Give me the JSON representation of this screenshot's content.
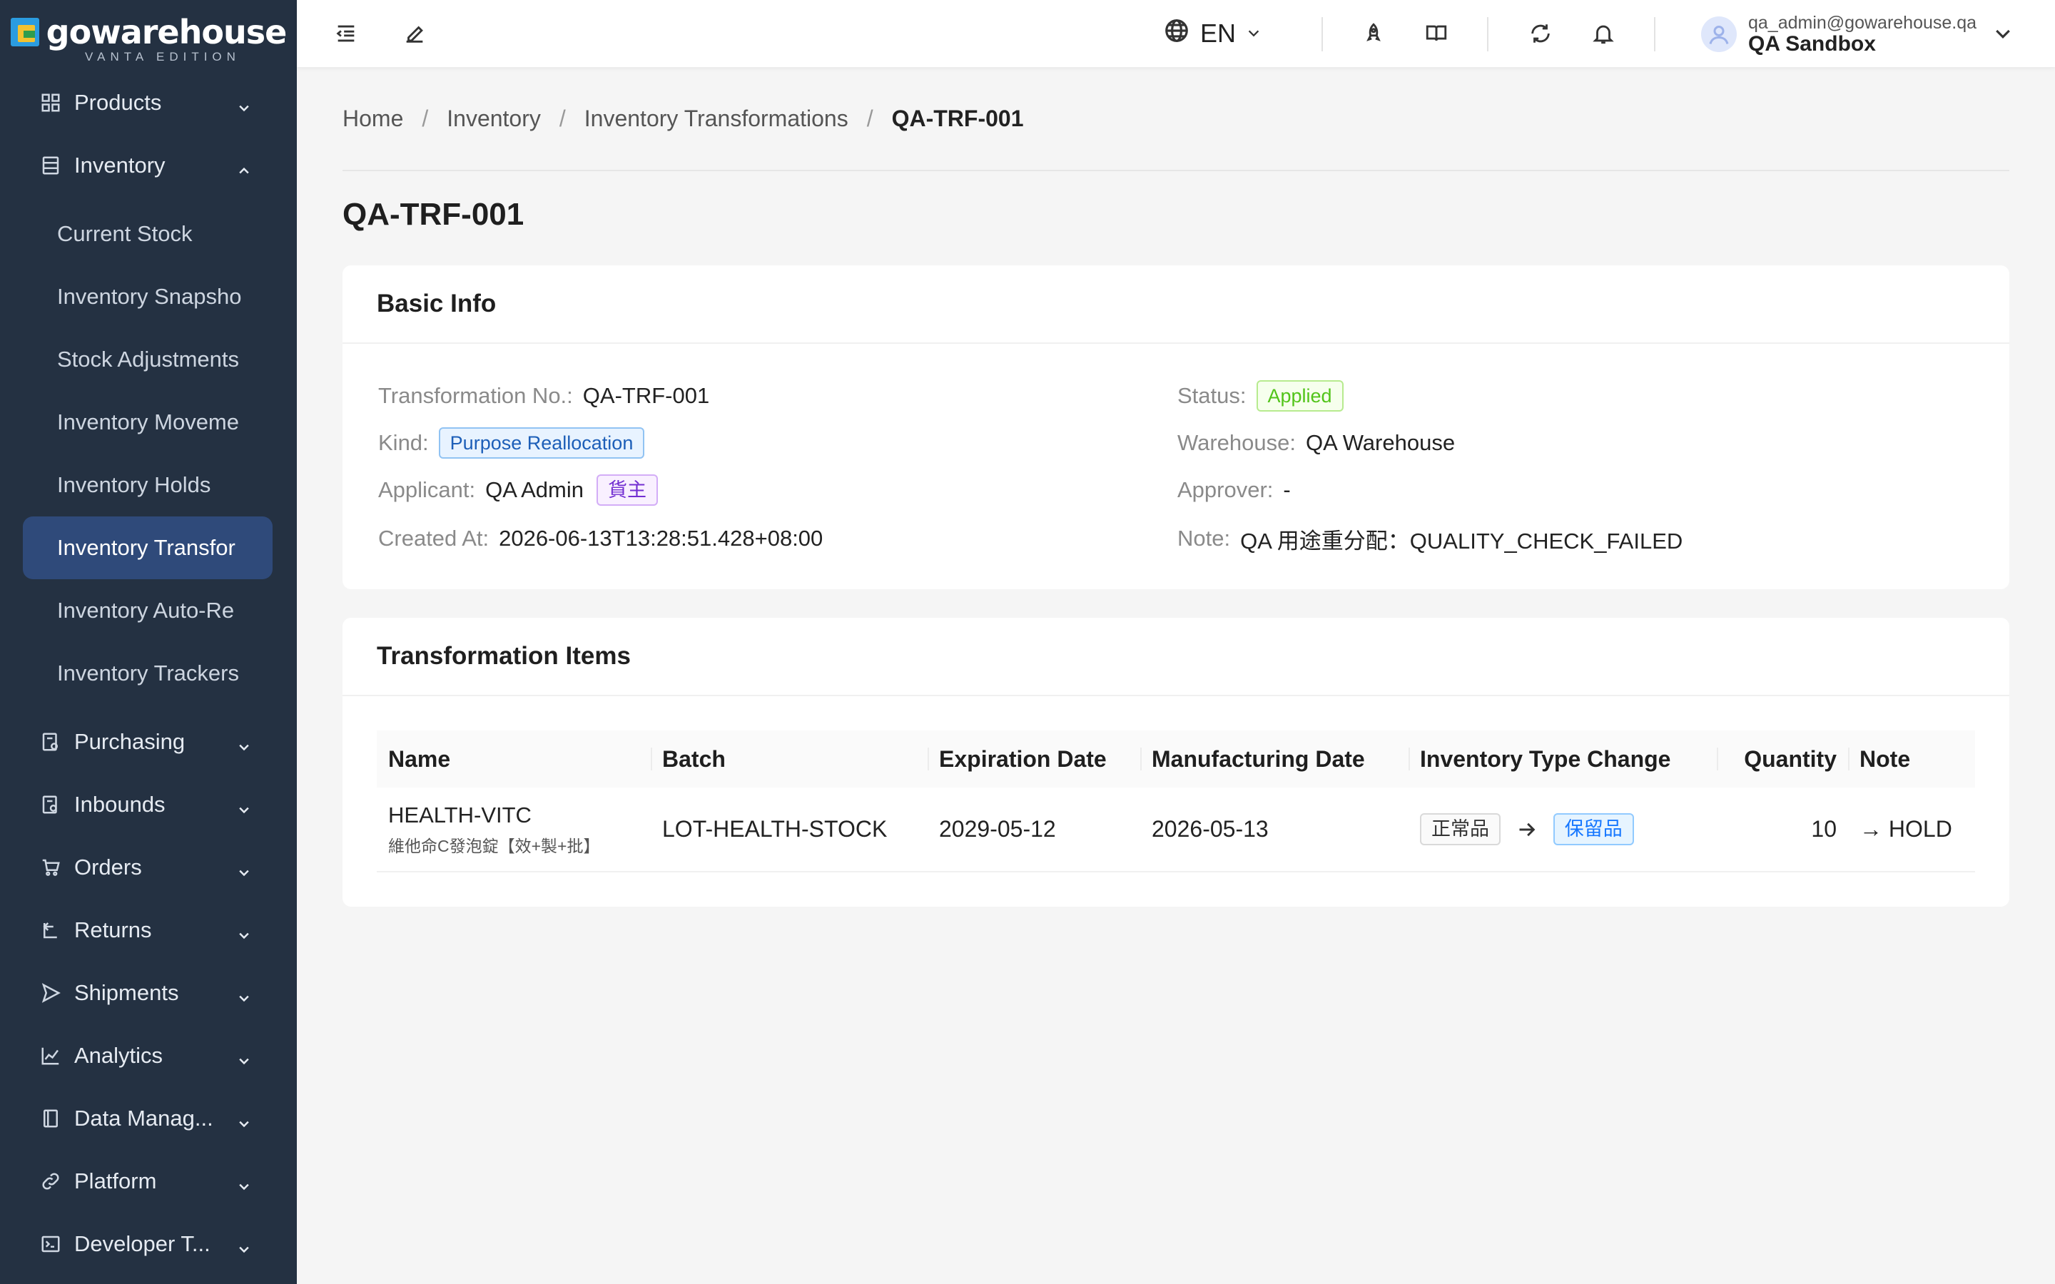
{
  "brand": {
    "name": "gowarehouse",
    "edition": "VANTA EDITION"
  },
  "sidebar": {
    "items": [
      {
        "label": "Products"
      },
      {
        "label": "Inventory"
      },
      {
        "label": "Purchasing"
      },
      {
        "label": "Inbounds"
      },
      {
        "label": "Orders"
      },
      {
        "label": "Returns"
      },
      {
        "label": "Shipments"
      },
      {
        "label": "Analytics"
      },
      {
        "label": "Data Manag..."
      },
      {
        "label": "Platform"
      },
      {
        "label": "Developer T..."
      }
    ],
    "inventory_sub": [
      {
        "label": "Current Stock"
      },
      {
        "label": "Inventory Snapsho"
      },
      {
        "label": "Stock Adjustments"
      },
      {
        "label": "Inventory Moveme"
      },
      {
        "label": "Inventory Holds"
      },
      {
        "label": "Inventory Transfor"
      },
      {
        "label": "Inventory Auto-Re"
      },
      {
        "label": "Inventory Trackers"
      }
    ]
  },
  "topbar": {
    "language": "EN",
    "user_email": "qa_admin@gowarehouse.qa",
    "user_org": "QA Sandbox"
  },
  "breadcrumb": {
    "home": "Home",
    "inventory": "Inventory",
    "section": "Inventory Transformations",
    "current": "QA-TRF-001"
  },
  "page_title": "QA-TRF-001",
  "basic_info": {
    "heading": "Basic Info",
    "transformation_no_label": "Transformation No.:",
    "transformation_no": "QA-TRF-001",
    "kind_label": "Kind:",
    "kind": "Purpose Reallocation",
    "applicant_label": "Applicant:",
    "applicant": "QA Admin",
    "applicant_tag": "貨主",
    "created_at_label": "Created At:",
    "created_at": "2026-06-13T13:28:51.428+08:00",
    "status_label": "Status:",
    "status": "Applied",
    "warehouse_label": "Warehouse:",
    "warehouse": "QA Warehouse",
    "approver_label": "Approver:",
    "approver": "-",
    "note_label": "Note:",
    "note": "QA 用途重分配：QUALITY_CHECK_FAILED"
  },
  "items": {
    "heading": "Transformation Items",
    "columns": [
      "Name",
      "Batch",
      "Expiration Date",
      "Manufacturing Date",
      "Inventory Type Change",
      "Quantity",
      "Note"
    ],
    "rows": [
      {
        "name": "HEALTH-VITC",
        "name_sub": "維他命C發泡錠【效+製+批】",
        "batch": "LOT-HEALTH-STOCK",
        "expiration": "2029-05-12",
        "manufacturing": "2026-05-13",
        "type_from": "正常品",
        "type_to": "保留品",
        "quantity": "10",
        "note": "→ HOLD"
      }
    ]
  }
}
